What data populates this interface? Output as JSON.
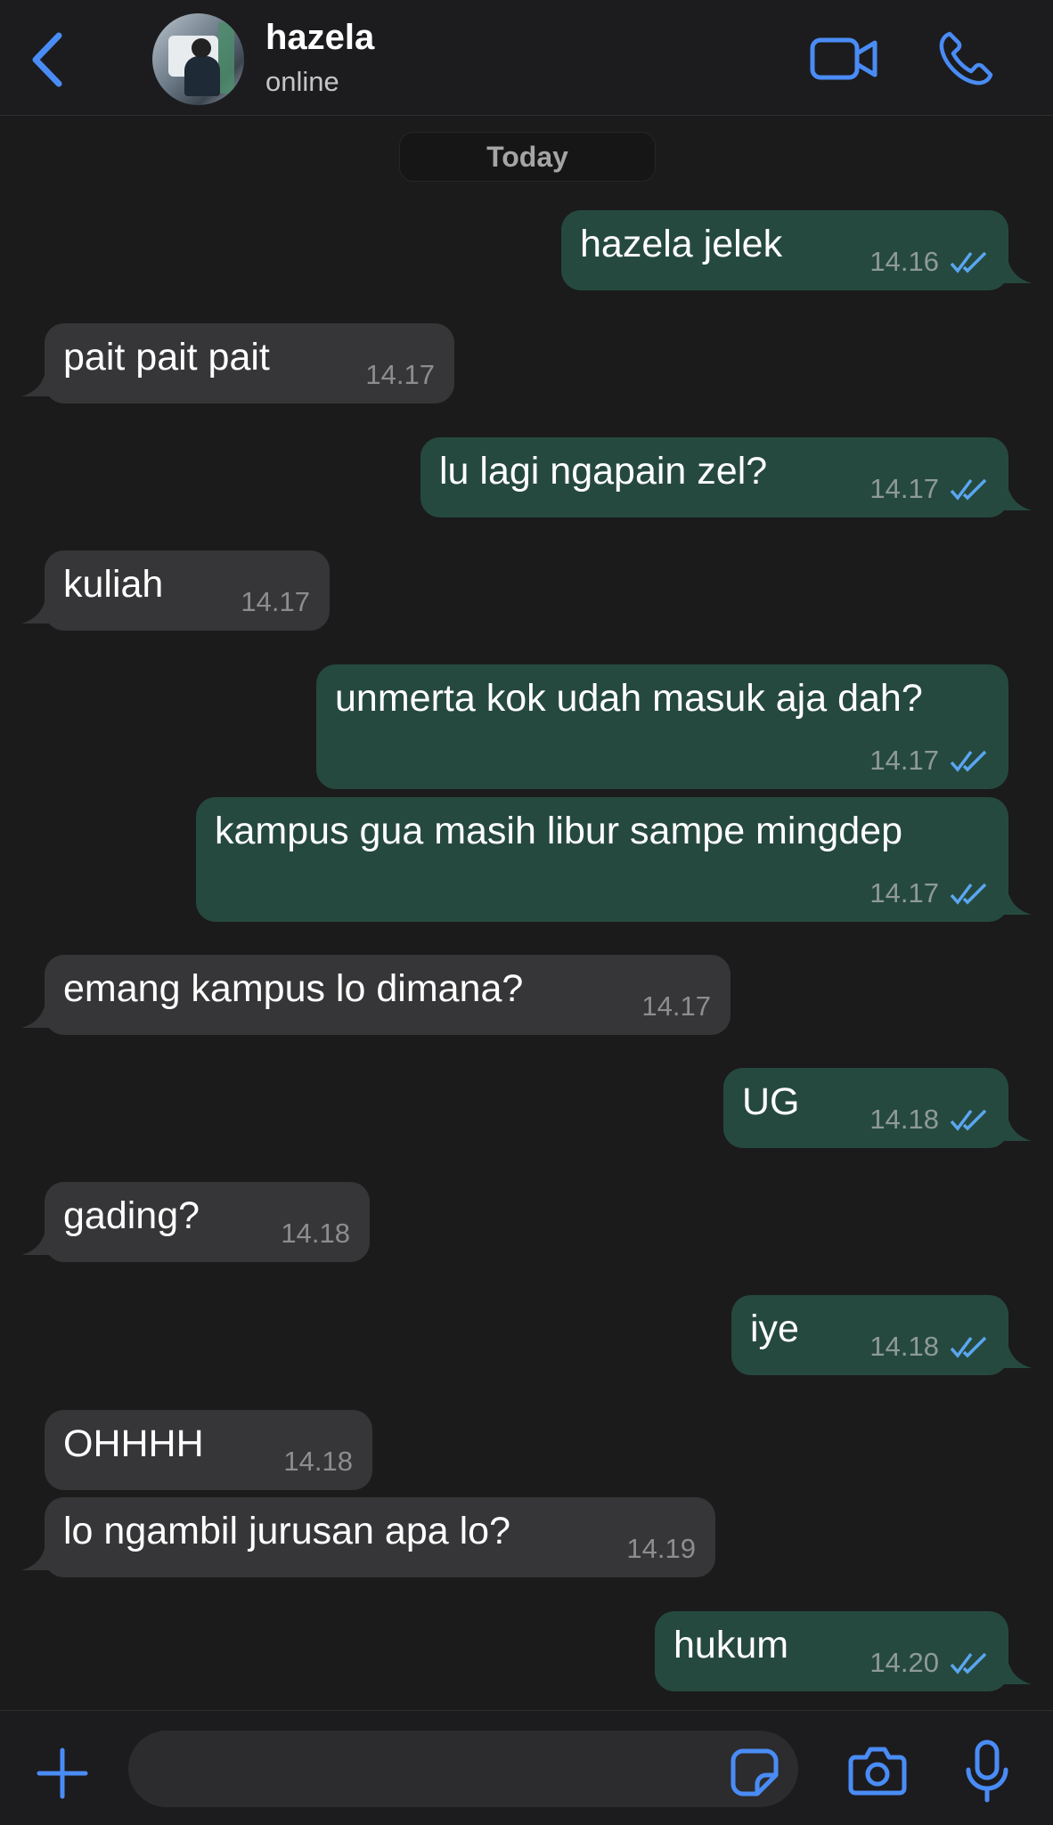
{
  "header": {
    "contact_name": "hazela",
    "contact_status": "online",
    "icons": [
      "back-chevron-icon",
      "video-call-icon",
      "phone-call-icon"
    ]
  },
  "date_divider": "Today",
  "messages": [
    {
      "dir": "out",
      "text": "hazela jelek",
      "time": "14.16",
      "read": true
    },
    {
      "dir": "in",
      "text": "pait pait pait",
      "time": "14.17"
    },
    {
      "dir": "out",
      "text": "lu lagi ngapain zel?",
      "time": "14.17",
      "read": true
    },
    {
      "dir": "in",
      "text": "kuliah",
      "time": "14.17"
    },
    {
      "dir": "out",
      "text": "unmerta kok udah masuk aja dah?",
      "time": "14.17",
      "read": true
    },
    {
      "dir": "out",
      "text": "kampus gua masih libur sampe mingdep",
      "time": "14.17",
      "read": true
    },
    {
      "dir": "in",
      "text": "emang kampus lo dimana?",
      "time": "14.17"
    },
    {
      "dir": "out",
      "text": "UG",
      "time": "14.18",
      "read": true
    },
    {
      "dir": "in",
      "text": "gading?",
      "time": "14.18"
    },
    {
      "dir": "out",
      "text": "iye",
      "time": "14.18",
      "read": true
    },
    {
      "dir": "in",
      "text": "OHHHH",
      "time": "14.18"
    },
    {
      "dir": "in",
      "text": "lo ngambil jurusan apa lo?",
      "time": "14.19"
    },
    {
      "dir": "out",
      "text": "hukum",
      "time": "14.20",
      "read": true
    }
  ],
  "input_bar": {
    "placeholder": "",
    "icons": [
      "plus-icon",
      "sticker-icon",
      "camera-icon",
      "microphone-icon"
    ]
  },
  "colors": {
    "accent": "#4a8cf6",
    "outgoing_bubble": "#26493f",
    "incoming_bubble": "#363638",
    "background": "#1b1b1b",
    "read_ticks": "#5aa6f0"
  }
}
